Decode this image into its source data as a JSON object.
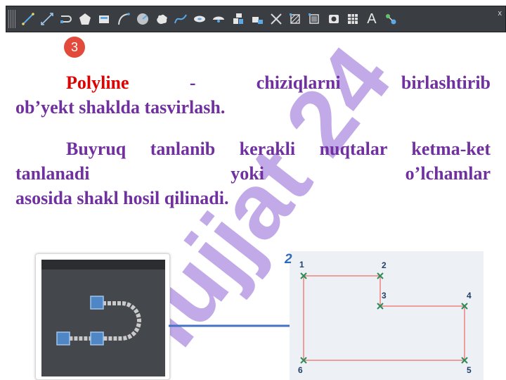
{
  "toolbar": {
    "icons": [
      "line-icon",
      "construction-line-icon",
      "polyline-icon",
      "polygon-icon",
      "rectangle-icon",
      "arc-icon",
      "circle-icon",
      "revision-cloud-icon",
      "spline-icon",
      "ellipse-icon",
      "ellipse-arc-icon",
      "insert-block-icon",
      "make-block-icon",
      "point-icon",
      "hatch-icon",
      "gradient-icon",
      "region-icon",
      "table-icon",
      "multiline-text-icon",
      "add-selected-icon"
    ],
    "close_label": "x",
    "text_tool_glyph": "A"
  },
  "badge": {
    "label": "3"
  },
  "watermark": {
    "text": "Hujjat 24"
  },
  "paragraph1": {
    "keyword": "Polyline",
    "line1_rest": "- chiziqlarni birlashtirib",
    "line2": "ob’yekt shaklda tasvirlash."
  },
  "paragraph2": {
    "line1": "Buyruq tanlanib kerakli nuqtalar",
    "line2": "ketma-ket tanlanadi yoki o’lchamlar",
    "line3": "asosida shakl hosil qilinadi."
  },
  "diagram": {
    "number": "2",
    "points": [
      "1",
      "2",
      "3",
      "4",
      "5",
      "6"
    ]
  },
  "colors": {
    "text": "#7030a0",
    "keyword": "#e00000",
    "badge": "#e24a3b",
    "arrow": "#4472c4",
    "watermark": "#b79ae3",
    "polyline": "#f08080",
    "marker": "#2e8b57"
  }
}
